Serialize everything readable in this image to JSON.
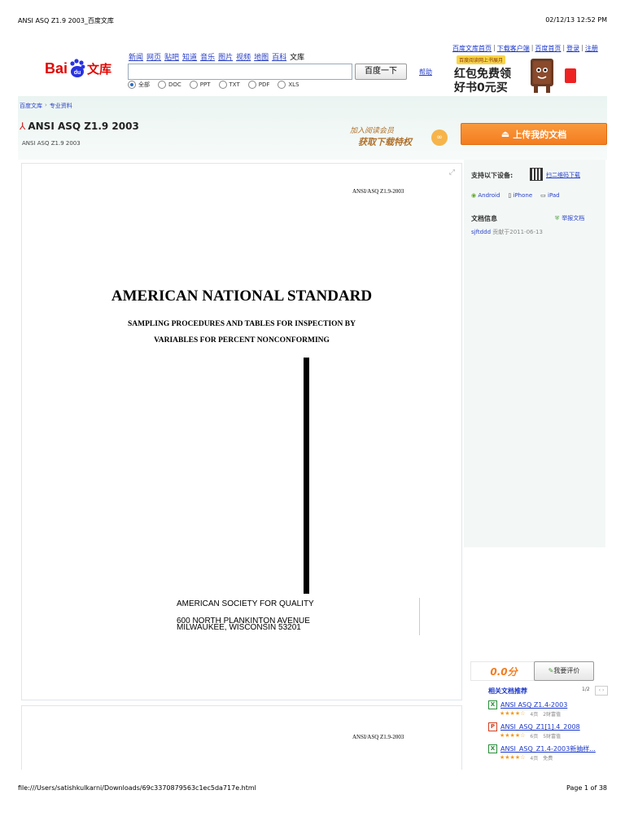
{
  "print_header": {
    "left": "ANSI ASQ Z1.9 2003_百度文库",
    "right": "02/12/13 12:52 PM"
  },
  "print_footer": {
    "left": "file:///Users/satishkulkarni/Downloads/69c3370879563c1ec5da717e.html",
    "right": "Page 1 of 38"
  },
  "logo": {
    "text_bai": "Bai",
    "text_du": "du",
    "text_wenku": "文库"
  },
  "nav": {
    "items": [
      "新闻",
      "网页",
      "贴吧",
      "知道",
      "音乐",
      "图片",
      "视频",
      "地图",
      "百科"
    ],
    "current": "文库"
  },
  "search": {
    "value": "",
    "button": "百度一下",
    "help": "帮助"
  },
  "filters": [
    "全部",
    "DOC",
    "PPT",
    "TXT",
    "PDF",
    "XLS"
  ],
  "top_links": [
    "百度文库首页",
    "下载客户端",
    "百度首页",
    "登录",
    "注册"
  ],
  "ad": {
    "badge": "百度阅读网上书展月",
    "line1": "红包免费领",
    "line2": "好书0元买"
  },
  "breadcrumb": {
    "home": "百度文库",
    "sep": "›",
    "section": "专业资料"
  },
  "doc": {
    "title": "ANSI ASQ Z1.9 2003",
    "subtitle": "ANSI ASQ Z1.9 2003",
    "promo_line1": "加入阅读会员",
    "promo_line2": "获取下载特权",
    "upload_button": "上传我的文档"
  },
  "page1": {
    "code": "ANSI/ASQ Z1.9-2003",
    "heading": "AMERICAN NATIONAL STANDARD",
    "sub1": "SAMPLING PROCEDURES AND TABLES FOR INSPECTION BY",
    "sub2": "VARIABLES FOR PERCENT NONCONFORMING",
    "org": "AMERICAN SOCIETY FOR QUALITY",
    "addr1": "600 NORTH PLANKINTON AVENUE",
    "addr2": "MILWAUKEE, WISCONSIN 53201"
  },
  "page2": {
    "code": "ANSI/ASQ Z1.9-2003"
  },
  "sidebar": {
    "devices_label": "支持以下设备:",
    "qr_link": "扫二维码下载",
    "devices": [
      "Android",
      "iPhone",
      "iPad"
    ],
    "info_label": "文档信息",
    "report_link": "举报文档",
    "uploader": "sjftddd",
    "uploaded": "贡献于2011-06-13",
    "score": "0.0分",
    "rate_button": "我要评价",
    "related_label": "相关文档推荐",
    "pager": "1/2",
    "related": [
      {
        "type": "xls",
        "title": "ANSI ASQ Z1.4-2003",
        "stars": "★★★★☆",
        "pages": "4页",
        "cost": "2财富值"
      },
      {
        "type": "ppt",
        "title": "ANSI_ASQ_Z1[1].4_2008",
        "stars": "★★★★☆",
        "pages": "6页",
        "cost": "5财富值"
      },
      {
        "type": "xls",
        "title": "ANSI_ASQ_Z1.4-2003新抽样...",
        "stars": "★★★★☆",
        "pages": "4页",
        "cost": "免费"
      }
    ]
  },
  "colors": {
    "accent_orange": "#f47c20",
    "baidu_blue": "#2932e1",
    "baidu_red": "#e10602",
    "link_blue": "#2a41c8",
    "border": "#dfe6ea"
  }
}
